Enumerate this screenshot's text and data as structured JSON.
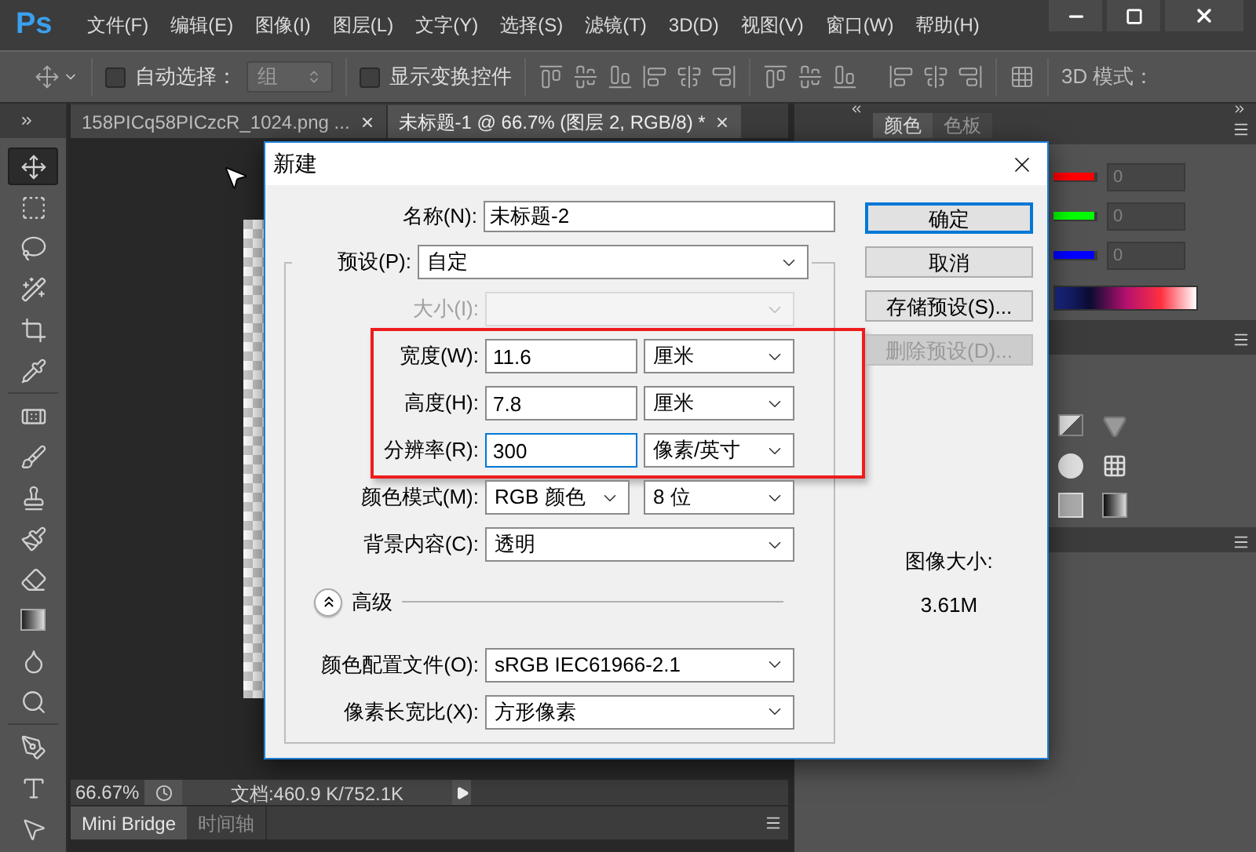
{
  "app": {
    "logo": "Ps"
  },
  "menu": [
    "文件(F)",
    "编辑(E)",
    "图像(I)",
    "图层(L)",
    "文字(Y)",
    "选择(S)",
    "滤镜(T)",
    "3D(D)",
    "视图(V)",
    "窗口(W)",
    "帮助(H)"
  ],
  "options_bar": {
    "auto_select": {
      "label": "自动选择：",
      "checked": false
    },
    "auto_select_target": "组",
    "show_transform": {
      "label": "显示变换控件",
      "checked": false
    },
    "mode_label": "3D 模式："
  },
  "document_tabs": [
    {
      "label": "158PICq58PICzcR_1024.png ...",
      "selected": false
    },
    {
      "label": "未标题-1 @ 66.7% (图层 2, RGB/8) *",
      "selected": true
    }
  ],
  "tool_groups": [
    [
      {
        "kind": "move",
        "selected": true
      },
      {
        "kind": "marquee",
        "selected": false
      },
      {
        "kind": "lasso",
        "selected": false
      },
      {
        "kind": "quick_select",
        "selected": false
      },
      {
        "kind": "crop",
        "selected": false
      },
      {
        "kind": "eyedropper",
        "selected": false
      }
    ],
    [
      {
        "kind": "healing",
        "selected": false
      },
      {
        "kind": "brush",
        "selected": false
      },
      {
        "kind": "stamp",
        "selected": false
      },
      {
        "kind": "history_brush",
        "selected": false
      },
      {
        "kind": "eraser",
        "selected": false
      },
      {
        "kind": "gradient",
        "selected": false
      },
      {
        "kind": "blur",
        "selected": false
      },
      {
        "kind": "dodge",
        "selected": false
      }
    ],
    [
      {
        "kind": "pen",
        "selected": false
      },
      {
        "kind": "type",
        "selected": false
      },
      {
        "kind": "path_select",
        "selected": false
      }
    ]
  ],
  "status_bar": {
    "zoom": "66.67%",
    "doc_info": "文档:460.9 K/752.1K"
  },
  "bottom_tabs": [
    {
      "label": "Mini Bridge",
      "selected": true
    },
    {
      "label": "时间轴",
      "selected": false
    }
  ],
  "color_panel": {
    "tabs": [
      {
        "label": "颜色",
        "selected": true
      },
      {
        "label": "色板",
        "selected": false
      }
    ],
    "channels": [
      {
        "color": "#ff0000",
        "value": "0"
      },
      {
        "color": "#00ff00",
        "value": "0"
      },
      {
        "color": "#0000ff",
        "value": "0"
      }
    ]
  },
  "dialog": {
    "title": "新建",
    "name": {
      "label": "名称(N):",
      "value": "未标题-2"
    },
    "preset": {
      "label": "预设(P):",
      "value": "自定"
    },
    "rows": [
      {
        "kind": "select",
        "label": "大小(I):",
        "disabled": true,
        "focused": false,
        "highlighted": false
      },
      {
        "kind": "input_unit",
        "label": "宽度(W):",
        "value": "11.6",
        "unit": "厘米",
        "disabled": false,
        "focused": false,
        "highlighted": true
      },
      {
        "kind": "input_unit",
        "label": "高度(H):",
        "value": "7.8",
        "unit": "厘米",
        "disabled": false,
        "focused": false,
        "highlighted": true
      },
      {
        "kind": "input_unit",
        "label": "分辨率(R):",
        "value": "300",
        "unit": "像素/英寸",
        "disabled": false,
        "focused": true,
        "highlighted": true
      },
      {
        "kind": "select_pair",
        "label": "颜色模式(M):",
        "value": "RGB 颜色",
        "unit": "8 位",
        "disabled": false,
        "focused": false,
        "highlighted": false
      },
      {
        "kind": "select",
        "label": "背景内容(C):",
        "value": "透明",
        "disabled": false,
        "focused": false,
        "highlighted": false
      }
    ],
    "advanced": {
      "label": "高级",
      "expanded": true,
      "rows": [
        {
          "label": "颜色配置文件(O):",
          "value": "sRGB IEC61966-2.1"
        },
        {
          "label": "像素长宽比(X):",
          "value": "方形像素"
        }
      ]
    },
    "buttons": [
      {
        "label": "确定",
        "default": true,
        "disabled": false
      },
      {
        "label": "取消",
        "default": false,
        "disabled": false
      },
      {
        "label": "存储预设(S)...",
        "default": false,
        "disabled": false
      },
      {
        "label": "删除预设(D)...",
        "default": false,
        "disabled": true
      }
    ],
    "image_size": {
      "label": "图像大小:",
      "value": "3.61M"
    }
  }
}
